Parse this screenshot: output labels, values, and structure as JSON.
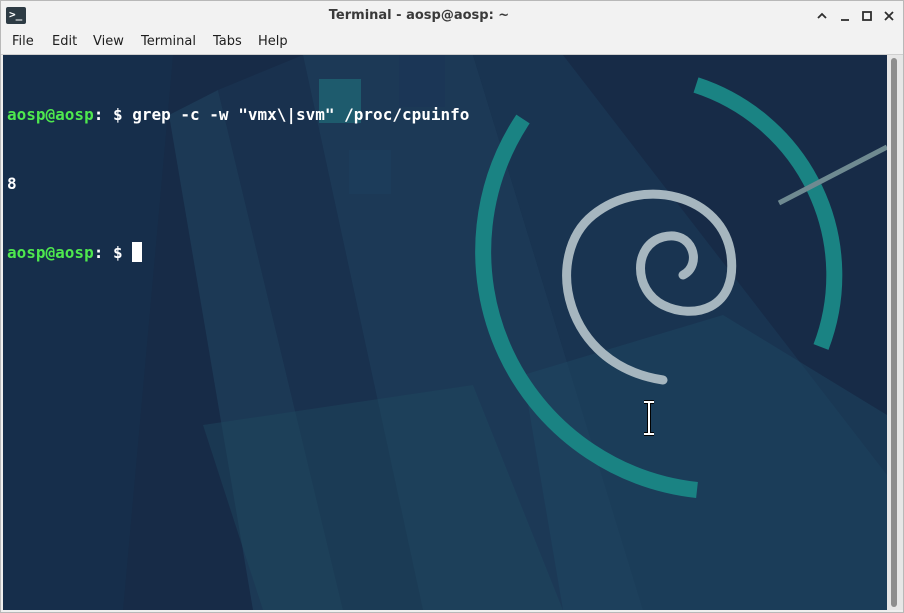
{
  "window": {
    "title": "Terminal - aosp@aosp: ~",
    "app_icon_glyph": ">_",
    "controls": [
      "minimize-up",
      "minimize",
      "maximize",
      "close"
    ]
  },
  "menu": {
    "items": [
      "File",
      "Edit",
      "View",
      "Terminal",
      "Tabs",
      "Help"
    ]
  },
  "terminal": {
    "lines": [
      {
        "user_host": "aosp@aosp",
        "path_sep": ": $ ",
        "command": "grep -c -w \"vmx\\|svm\" /proc/cpuinfo"
      },
      {
        "output": "8"
      },
      {
        "user_host": "aosp@aosp",
        "path_sep": ": $ ",
        "command": ""
      }
    ],
    "colors": {
      "background": "#172b47",
      "prompt": "#4ee84e",
      "text": "#ffffff",
      "accent_teal": "#1a8383"
    }
  }
}
